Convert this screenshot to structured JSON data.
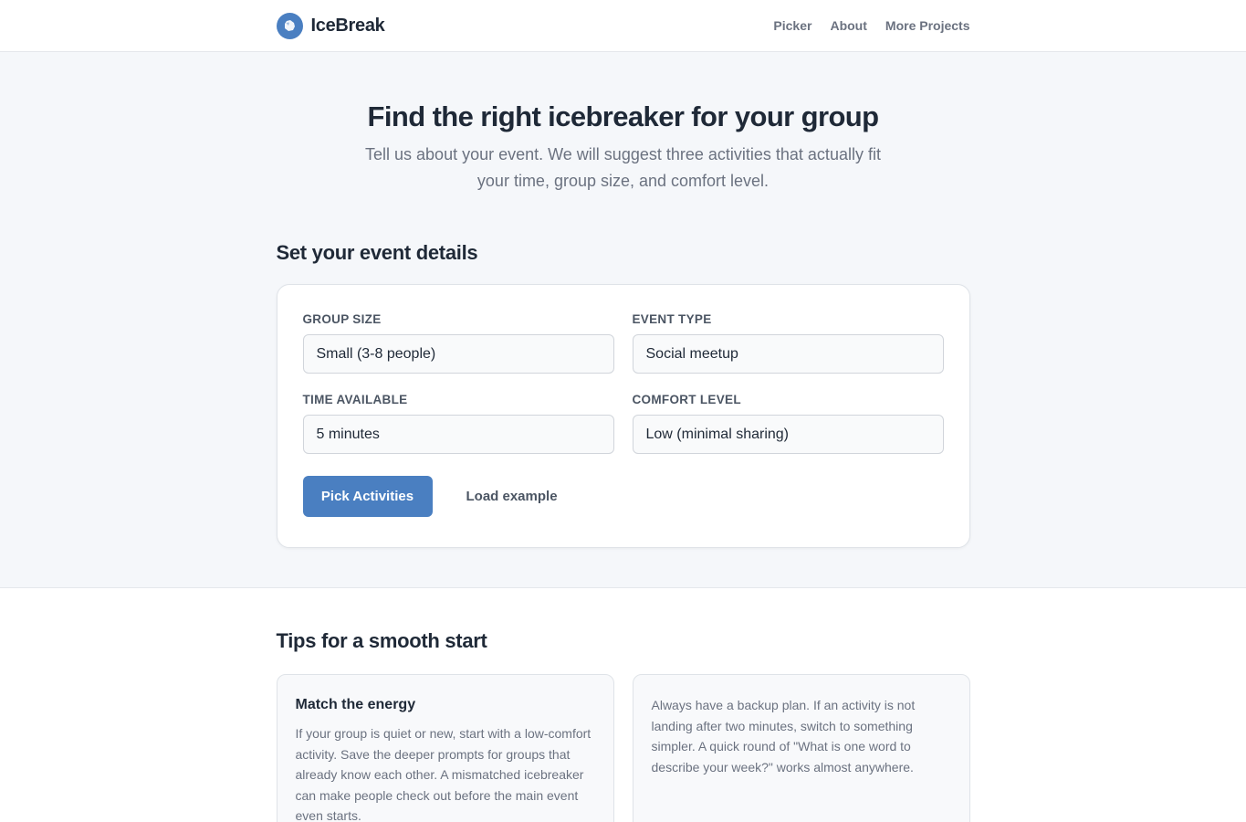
{
  "brand": {
    "name": "IceBreak",
    "logo_icon": "ice-cube-icon",
    "accent": "#4a7fc1"
  },
  "nav": {
    "items": [
      "Picker",
      "About",
      "More Projects"
    ]
  },
  "hero": {
    "title": "Find the right icebreaker for your group",
    "subtitle": "Tell us about your event. We will suggest three activities that actually fit your time, group size, and comfort level."
  },
  "details": {
    "title": "Set your event details",
    "fields": [
      {
        "label": "Group size",
        "value": "Small (3-8 people)"
      },
      {
        "label": "Event type",
        "value": "Social meetup"
      },
      {
        "label": "Time available",
        "value": "5 minutes"
      },
      {
        "label": "Comfort level",
        "value": "Low (minimal sharing)"
      }
    ],
    "primary_button": "Pick Activities",
    "secondary_button": "Load example"
  },
  "tips": {
    "title": "Tips for a smooth start",
    "cards": [
      {
        "title": "Match the energy",
        "body": "If your group is quiet or new, start with a low-comfort activity. Save the deeper prompts for groups that already know each other. A mismatched icebreaker can make people check out before the main event even starts."
      },
      {
        "title": "",
        "body": "Always have a backup plan. If an activity is not landing after two minutes, switch to something simpler. A quick round of \"What is one word to describe your week?\" works almost anywhere."
      }
    ]
  }
}
